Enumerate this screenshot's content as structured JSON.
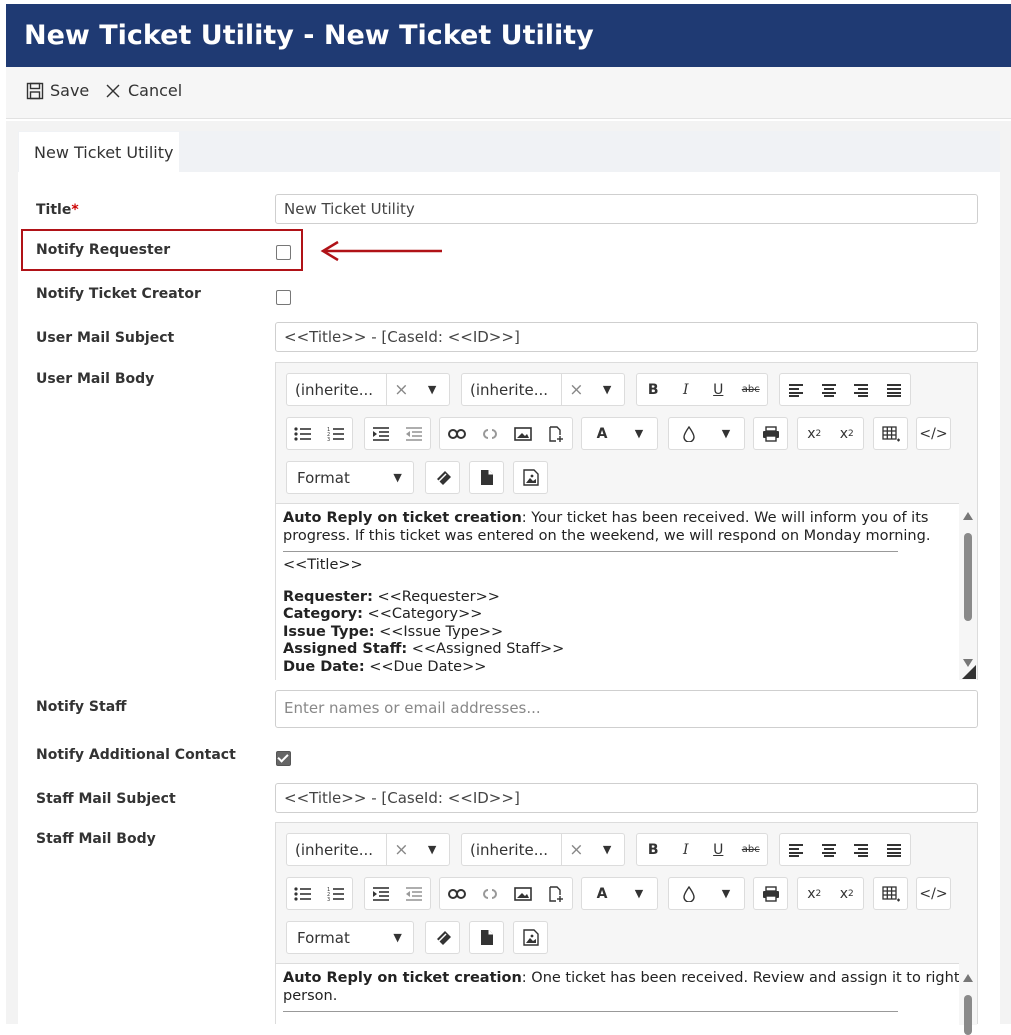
{
  "window": {
    "title": "New Ticket Utility - New Ticket Utility"
  },
  "toolbar": {
    "save_label": "Save",
    "cancel_label": "Cancel"
  },
  "tabs": [
    {
      "label": "New Ticket Utility"
    }
  ],
  "form": {
    "title_label": "Title",
    "title_required_mark": "*",
    "title_value": "New Ticket Utility",
    "notify_requester_label": "Notify Requester",
    "notify_requester_checked": false,
    "notify_ticket_creator_label": "Notify Ticket Creator",
    "notify_ticket_creator_checked": false,
    "user_mail_subject_label": "User Mail Subject",
    "user_mail_subject_value": "<<Title>> - [CaseId: <<ID>>]",
    "user_mail_body_label": "User Mail Body",
    "notify_staff_label": "Notify Staff",
    "notify_staff_placeholder": "Enter names or email addresses...",
    "notify_additional_contact_label": "Notify Additional Contact",
    "notify_additional_contact_checked": true,
    "staff_mail_subject_label": "Staff Mail Subject",
    "staff_mail_subject_value": "<<Title>> - [CaseId: <<ID>>]",
    "staff_mail_body_label": "Staff Mail Body"
  },
  "editor_toolbar": {
    "font_family": "(inherite...",
    "font_size": "(inherite...",
    "format_label": "Format",
    "clear_mark": "×",
    "dropdown_mark": "▼"
  },
  "user_mail_body": {
    "intro_bold": "Auto Reply on ticket creation",
    "intro_text": ": Your ticket has been received. We will inform you of its progress. If this ticket was entered on the weekend, we will respond on Monday morning.",
    "title_token": "<<Title>>",
    "fields": [
      {
        "label": "Requester:",
        "value": " <<Requester>>"
      },
      {
        "label": "Category:",
        "value": " <<Category>>"
      },
      {
        "label": "Issue Type:",
        "value": " <<Issue Type>>"
      },
      {
        "label": "Assigned Staff:",
        "value": " <<Assigned Staff>>"
      },
      {
        "label": "Due Date:",
        "value": " <<Due Date>>"
      }
    ]
  },
  "staff_mail_body": {
    "intro_bold": "Auto Reply on ticket creation",
    "intro_text": ": One ticket has been received. Review and assign it to right person."
  },
  "colors": {
    "title_bar": "#1f3a73",
    "highlight": "#b01217"
  }
}
